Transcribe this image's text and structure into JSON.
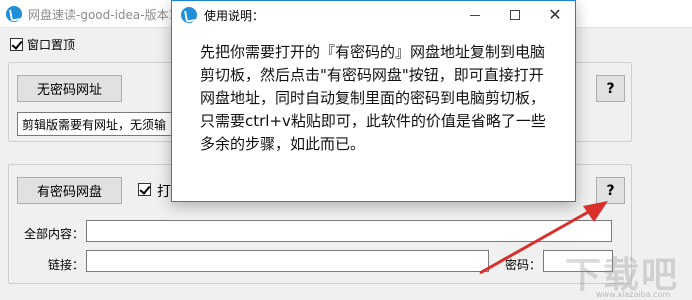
{
  "main_window": {
    "title": "网盘速读-good-idea-版本1",
    "topmost_label": "窗口置顶",
    "topmost_checked": true,
    "no_password": {
      "button_label": "无密码网址",
      "help_label": "?",
      "input_value": "剪辑版需要有网址，无须输"
    },
    "with_password": {
      "button_label": "有密码网盘",
      "open_checkbox_label": "打",
      "open_checked": true,
      "help_label": "?",
      "all_content_label": "全部内容：",
      "all_content_value": "",
      "link_label": "链接：",
      "link_value": "",
      "password_label": "密码：",
      "password_value": ""
    }
  },
  "dialog": {
    "title": "使用说明：",
    "body": "先把你需要打开的『有密码的』网盘地址复制到电脑剪切板，然后点击\"有密码网盘\"按钮，即可直接打开网盘地址，同时自动复制里面的密码到电脑剪切板，只需要ctrl+v粘贴即可，此软件的价值是省略了一些多余的步骤，如此而已。"
  },
  "overlay": {
    "watermark": "下载吧",
    "watermark_url": "www.xiazaiba.com",
    "arrow_color": "#d9302b"
  },
  "colors": {
    "accent": "#1883d7",
    "app_icon": "#1e8fd8"
  },
  "icons": {
    "app": "app-logo-icon",
    "dialog": "app-logo-icon"
  }
}
